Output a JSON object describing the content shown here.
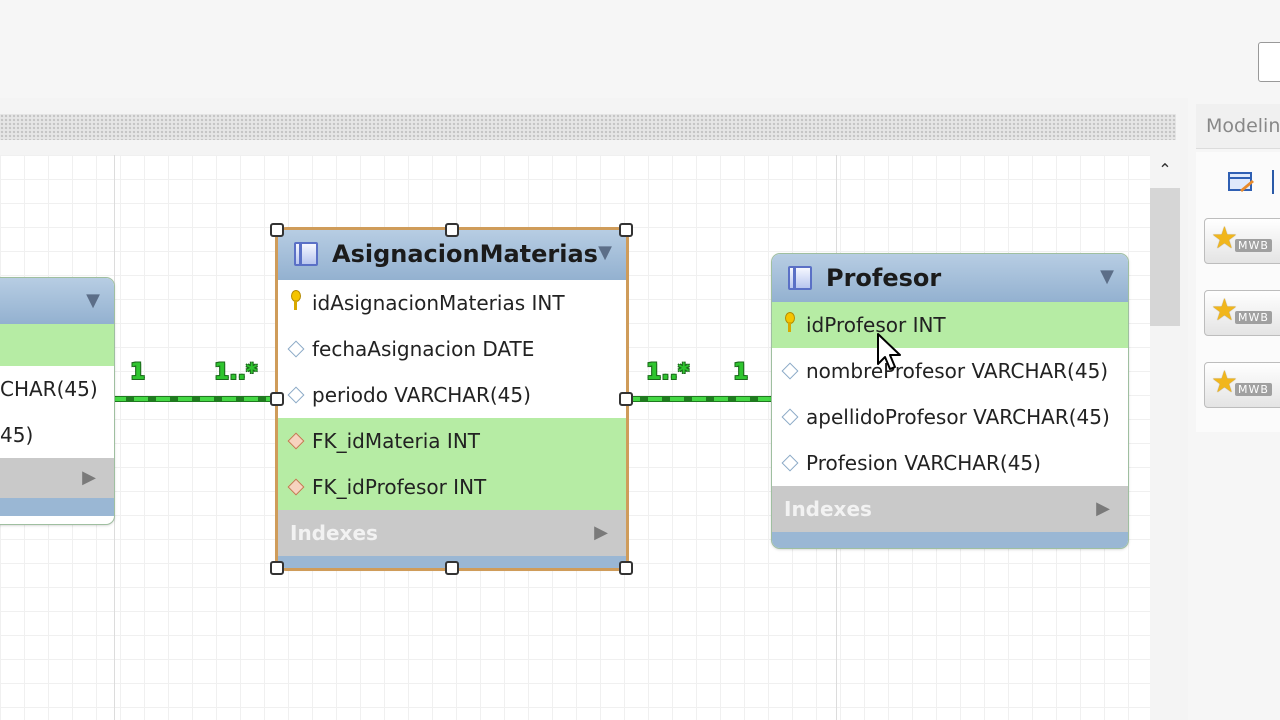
{
  "right_panel": {
    "title": "Modelin",
    "mwb_buttons": [
      {
        "icon": "star-icon",
        "label": "MWB"
      },
      {
        "icon": "star-icon",
        "label": "MWB"
      },
      {
        "icon": "star-icon",
        "label": "MWB"
      }
    ]
  },
  "diagram": {
    "left_table": {
      "rows": [
        "CHAR(45)",
        "45)"
      ]
    },
    "asignacion": {
      "title": "AsignacionMaterias",
      "columns": [
        "idAsignacionMaterias INT",
        "fechaAsignacion DATE",
        "periodo VARCHAR(45)",
        "FK_idMateria INT",
        "FK_idProfesor INT"
      ],
      "indexes_label": "Indexes"
    },
    "profesor": {
      "title": "Profesor",
      "columns": [
        "idProfesor INT",
        "nombreProfesor VARCHAR(45)",
        "apellidoProfesor VARCHAR(45)",
        "Profesion VARCHAR(45)"
      ],
      "indexes_label": "Indexes"
    },
    "relationships": [
      {
        "one": "1",
        "many": "1..*"
      },
      {
        "one": "1",
        "many": "1..*"
      }
    ]
  },
  "colors": {
    "relationship": "#33cc33",
    "selection": "#cf9c5a",
    "highlight_row": "#b6eca4",
    "table_header": "#93b1d0"
  }
}
